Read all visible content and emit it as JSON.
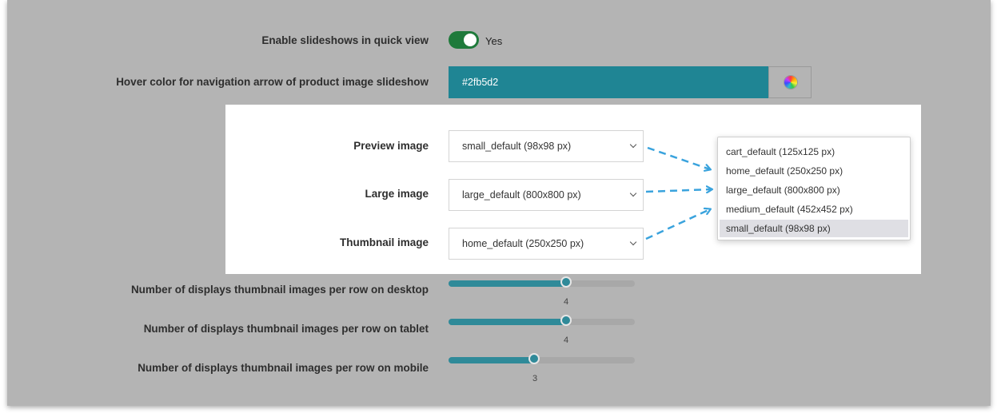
{
  "settings": {
    "slideshow": {
      "label": "Enable slideshows in quick view",
      "toggle_text": "Yes",
      "enabled": true
    },
    "hover_color": {
      "label": "Hover color for navigation arrow of product image slideshow",
      "value": "#2fb5d2",
      "icon": "color-wheel-icon"
    }
  },
  "images": {
    "preview": {
      "label": "Preview image",
      "value": "small_default (98x98 px)"
    },
    "large": {
      "label": "Large image",
      "value": "large_default (800x800 px)"
    },
    "thumbnail": {
      "label": "Thumbnail image",
      "value": "home_default (250x250 px)"
    }
  },
  "dropdown": {
    "options": [
      "cart_default (125x125 px)",
      "home_default (250x250 px)",
      "large_default (800x800 px)",
      "medium_default (452x452 px)",
      "small_default (98x98 px)"
    ],
    "selected": "small_default (98x98 px)"
  },
  "sliders": {
    "desktop": {
      "label": "Number of displays thumbnail images per row on desktop",
      "value": "4",
      "level": 0.63
    },
    "tablet": {
      "label": "Number of displays thumbnail images per row on tablet",
      "value": "4",
      "level": 0.63
    },
    "mobile": {
      "label": "Number of displays thumbnail images per row on mobile",
      "value": "3",
      "level": 0.46
    }
  },
  "colors": {
    "panel_bg": "#b4b4b4",
    "accent": "#2f8a99",
    "toggle_on": "#1f7a3b",
    "arrow": "#3aa3dd"
  }
}
